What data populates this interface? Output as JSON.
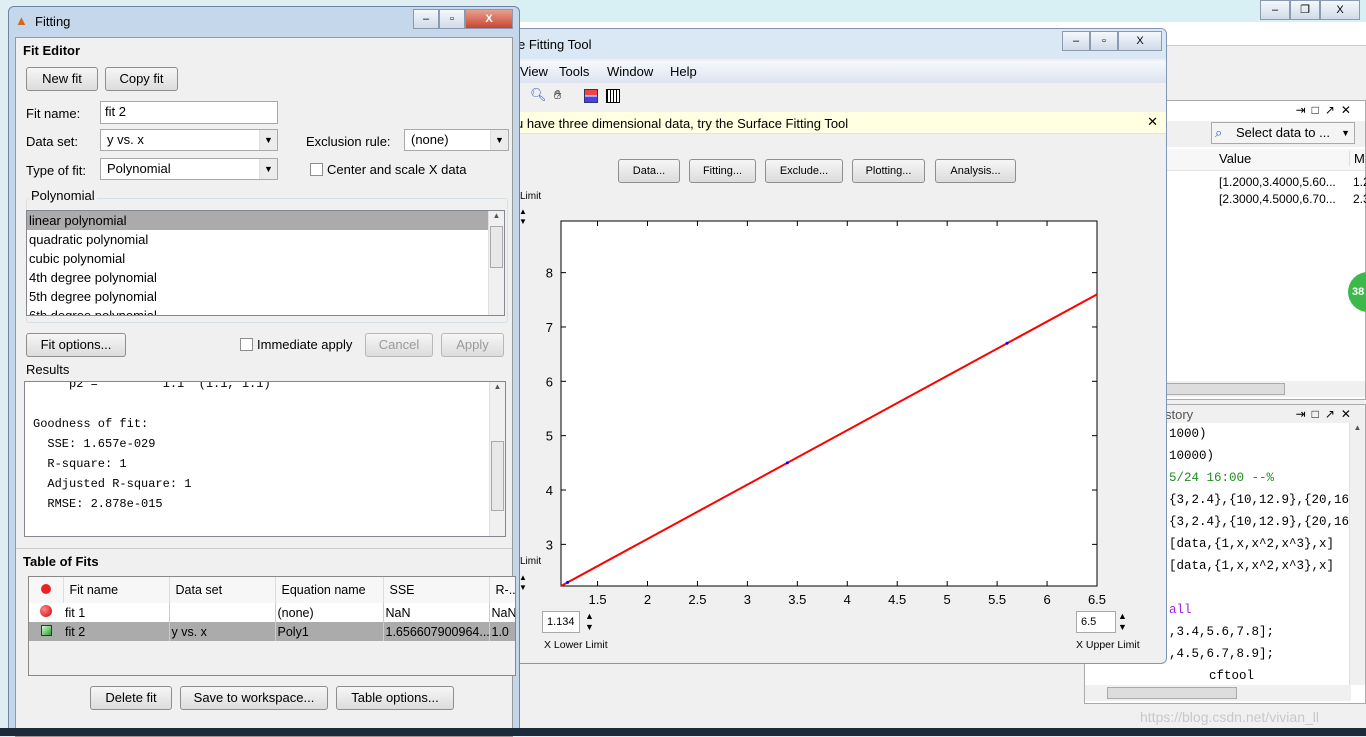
{
  "desktop": {
    "watermark": "https://blog.csdn.net/vivian_ll"
  },
  "fitting_window": {
    "title": "Fitting",
    "fit_editor": {
      "heading": "Fit Editor",
      "new_fit": "New fit",
      "copy_fit": "Copy fit",
      "fit_name_label": "Fit name:",
      "fit_name_value": "fit 2",
      "data_set_label": "Data set:",
      "data_set_value": "y vs. x",
      "exclusion_label": "Exclusion rule:",
      "exclusion_value": "(none)",
      "type_label": "Type of fit:",
      "type_value": "Polynomial",
      "center_scale_label": "Center and scale X data",
      "center_scale_checked": false,
      "group_label": "Polynomial",
      "poly_options": [
        "linear polynomial",
        "quadratic polynomial",
        "cubic polynomial",
        "4th degree polynomial",
        "5th degree polynomial",
        "6th degree polynomial"
      ],
      "selected_option": "linear polynomial",
      "fit_options": "Fit options...",
      "immediate_apply": "Immediate apply",
      "immediate_apply_checked": false,
      "cancel": "Cancel",
      "apply": "Apply",
      "results_label": "Results",
      "results_lines": [
        "     p2 =         1.1  (1.1, 1.1)",
        "",
        "Goodness of fit:",
        "  SSE: 1.657e-029",
        "  R-square: 1",
        "  Adjusted R-square: 1",
        "  RMSE: 2.878e-015"
      ]
    },
    "table_of_fits": {
      "heading": "Table of Fits",
      "columns": [
        "Fit name",
        "Data set",
        "Equation name",
        "SSE",
        "R-..."
      ],
      "rows": [
        {
          "icon": "red-circle",
          "name": "fit 1",
          "data_set": "",
          "equation": "(none)",
          "sse": "NaN",
          "r": "NaN"
        },
        {
          "icon": "green-square",
          "name": "fit 2",
          "data_set": "y vs. x",
          "equation": "Poly1",
          "sse": "1.656607900964...",
          "r": "1.0"
        }
      ],
      "delete_fit": "Delete fit",
      "save_to_workspace": "Save to workspace...",
      "table_options": "Table options..."
    }
  },
  "cftool_window": {
    "title": "e Fitting Tool",
    "menu": [
      "View",
      "Tools",
      "Window",
      "Help"
    ],
    "toolbar_icons": [
      "zoom-out-icon",
      "pan-hand-icon",
      "legend-icon",
      "grid-icon"
    ],
    "info_bar": "u have three dimensional data, try the Surface Fitting Tool",
    "buttons": [
      "Data...",
      "Fitting...",
      "Exclude...",
      "Plotting...",
      "Analysis..."
    ],
    "y_upper_label": "Limit",
    "y_lower_label": "Limit",
    "x_lower_value": "1.134",
    "x_lower_label": "X Lower Limit",
    "x_upper_value": "6.5",
    "x_upper_label": "X Upper Limit"
  },
  "chart_data": {
    "type": "line",
    "xlim": [
      1.134,
      6.5
    ],
    "ylim": [
      2.234,
      8.95
    ],
    "xticks": [
      1.5,
      2,
      2.5,
      3,
      3.5,
      4,
      4.5,
      5,
      5.5,
      6,
      6.5
    ],
    "yticks": [
      3,
      4,
      5,
      6,
      7,
      8
    ],
    "grid": false,
    "fit_line": {
      "p1": 1,
      "p2": 1.1,
      "color": "#ff0000"
    },
    "data_points": {
      "x": [
        1.2,
        3.4,
        5.6,
        7.8
      ],
      "y": [
        2.3,
        4.5,
        6.7,
        8.9
      ],
      "color": "#0000ff"
    }
  },
  "workspace": {
    "select_data": "Select data to ...",
    "columns": [
      "Value",
      "M"
    ],
    "rows": [
      [
        "[1.2000,3.4000,5.60...",
        "1.2"
      ],
      [
        "[2.3000,4.5000,6.70...",
        "2.3"
      ]
    ]
  },
  "history": {
    "title": "story",
    "lines": [
      {
        "text": "1000)",
        "color": "#000000"
      },
      {
        "text": "10000)",
        "color": "#000000"
      },
      {
        "text": "5/24 16:00 --%",
        "color": "#228b22"
      },
      {
        "text": "{3,2.4},{10,12.9},{20,16.3",
        "color": "#000000"
      },
      {
        "text": "{3,2.4},{10,12.9},{20,16.3",
        "color": "#000000"
      },
      {
        "text": "[data,{1,x,x^2,x^3},x]",
        "color": "#000000"
      },
      {
        "text": "[data,{1,x,x^2,x^3},x]",
        "color": "#000000"
      },
      {
        "text": "",
        "color": "#000000"
      },
      {
        "text": "all",
        "color": "#a020f0"
      },
      {
        "text": ",3.4,5.6,7.8];",
        "color": "#000000"
      },
      {
        "text": ",4.5,6.7,8.9];",
        "color": "#000000"
      },
      {
        "text": "cftool",
        "color": "#000000"
      }
    ],
    "badge": "38"
  }
}
